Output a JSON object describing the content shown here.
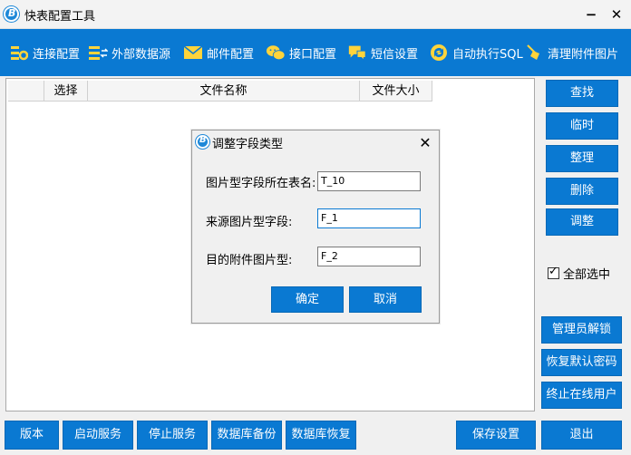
{
  "window": {
    "title": "快表配置工具",
    "minimize": "−",
    "close": "✕"
  },
  "toolbar": {
    "items": [
      {
        "label": "连接配置",
        "icon": "connection-settings-icon"
      },
      {
        "label": "外部数据源",
        "icon": "external-datasource-icon"
      },
      {
        "label": "邮件配置",
        "icon": "mail-icon"
      },
      {
        "label": "接口配置",
        "icon": "wechat-icon"
      },
      {
        "label": "短信设置",
        "icon": "sms-icon"
      },
      {
        "label": "自动执行SQL",
        "icon": "refresh-icon"
      },
      {
        "label": "清理附件图片",
        "icon": "broom-icon"
      }
    ]
  },
  "file_list": {
    "columns": [
      "",
      "选择",
      "文件名称",
      "文件大小"
    ],
    "rows": []
  },
  "side_buttons": [
    "查找",
    "临时",
    "整理",
    "删除",
    "调整"
  ],
  "select_all": {
    "label": "全部选中",
    "checked": true
  },
  "admin_buttons": [
    "管理员解锁",
    "恢复默认密码",
    "终止在线用户"
  ],
  "bottom_buttons": {
    "version": "版本",
    "start_service": "启动服务",
    "stop_service": "停止服务",
    "db_backup": "数据库备份",
    "db_restore": "数据库恢复",
    "save_settings": "保存设置",
    "exit": "退出"
  },
  "dialog": {
    "title": "调整字段类型",
    "close": "✕",
    "fields": [
      {
        "label": "图片型字段所在表名:",
        "value": "T_10"
      },
      {
        "label": "来源图片型字段:",
        "value": "F_1"
      },
      {
        "label": "目的附件图片型:",
        "value": "F_2"
      }
    ],
    "ok": "确定",
    "cancel": "取消"
  },
  "colors": {
    "accent": "#0a79d2"
  }
}
